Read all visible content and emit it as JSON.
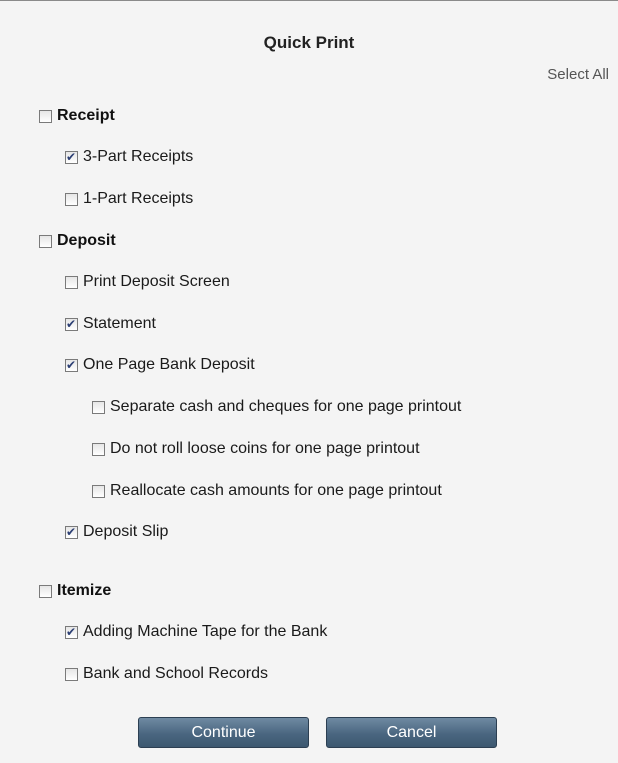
{
  "title": "Quick Print",
  "select_all": "Select All",
  "options": {
    "receipt": {
      "label": "Receipt",
      "checked": false
    },
    "three_part_receipts": {
      "label": "3-Part Receipts",
      "checked": true
    },
    "one_part_receipts": {
      "label": "1-Part Receipts",
      "checked": false
    },
    "deposit": {
      "label": "Deposit",
      "checked": false
    },
    "print_deposit_screen": {
      "label": "Print Deposit Screen",
      "checked": false
    },
    "statement": {
      "label": "Statement",
      "checked": true
    },
    "one_page_bank_deposit": {
      "label": "One Page Bank Deposit",
      "checked": true
    },
    "separate_cash": {
      "label": "Separate cash and cheques for one page printout",
      "checked": false
    },
    "no_roll_coins": {
      "label": "Do not roll loose coins for one page printout",
      "checked": false
    },
    "reallocate_cash": {
      "label": "Reallocate cash amounts for one page printout",
      "checked": false
    },
    "deposit_slip": {
      "label": "Deposit Slip",
      "checked": true
    },
    "itemize": {
      "label": "Itemize",
      "checked": false
    },
    "adding_machine_tape": {
      "label": "Adding Machine Tape for the Bank",
      "checked": true
    },
    "bank_school_records": {
      "label": "Bank and School Records",
      "checked": false
    }
  },
  "buttons": {
    "continue_label": "Continue",
    "cancel_label": "Cancel"
  }
}
